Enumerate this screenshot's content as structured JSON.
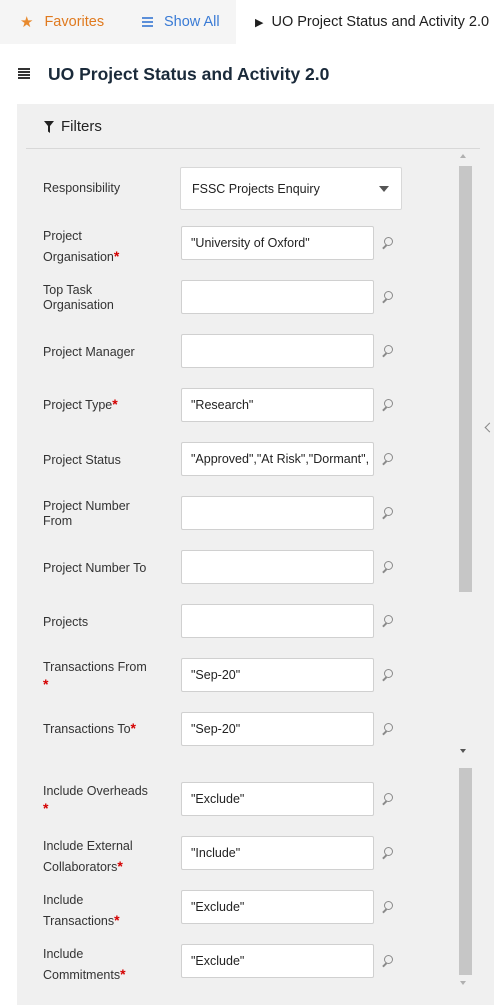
{
  "tabs": {
    "favorites": "Favorites",
    "show_all": "Show All",
    "active": "UO Project Status and Activity 2.0"
  },
  "page": {
    "title": "UO Project Status and Activity 2.0"
  },
  "filters": {
    "heading": "Filters",
    "responsibility": {
      "label": "Responsibility",
      "value": "FSSC Projects Enquiry"
    },
    "fields": [
      {
        "label": "Project Organisation",
        "required": true,
        "value": "\"University of Oxford\""
      },
      {
        "label": "Top Task Organisation",
        "required": false,
        "value": ""
      },
      {
        "label": "Project Manager",
        "required": false,
        "value": ""
      },
      {
        "label": "Project Type",
        "required": true,
        "value": "\"Research\""
      },
      {
        "label": "Project Status",
        "required": false,
        "value": "\"Approved\",\"At Risk\",\"Dormant\","
      },
      {
        "label": "Project Number From",
        "required": false,
        "value": ""
      },
      {
        "label": "Project Number To",
        "required": false,
        "value": ""
      },
      {
        "label": "Projects",
        "required": false,
        "value": ""
      },
      {
        "label": "Transactions From",
        "required": true,
        "value": "\"Sep-20\""
      },
      {
        "label": "Transactions To",
        "required": true,
        "value": "\"Sep-20\""
      },
      {
        "label": "Include Overheads",
        "required": true,
        "value": "\"Exclude\""
      },
      {
        "label": "Include External Collaborators",
        "required": true,
        "value": "\"Include\""
      },
      {
        "label": "Include Transactions",
        "required": true,
        "value": "\"Exclude\""
      },
      {
        "label": "Include Commitments",
        "required": true,
        "value": "\"Exclude\""
      }
    ],
    "required_marker": "*"
  },
  "colors": {
    "favorites": "#e07a1f",
    "show_all": "#3a7bd5",
    "required": "#d40000",
    "panel_bg": "#f0f0f0"
  },
  "icons": {
    "favorites": "star-icon",
    "show_all": "list-icon",
    "active": "play-icon",
    "page": "report-icon",
    "filters": "filter-icon",
    "lookup": "search-icon",
    "collapse": "chevron-left-icon"
  }
}
